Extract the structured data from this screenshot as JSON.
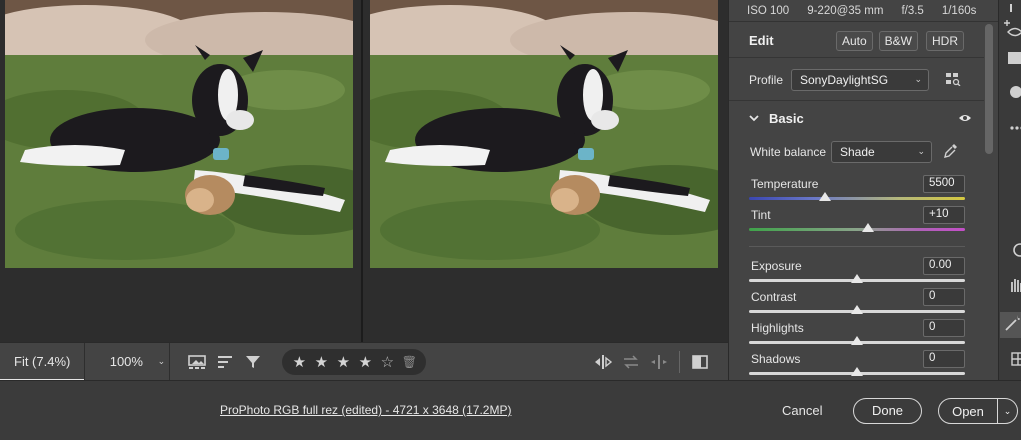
{
  "meta": {
    "iso": "ISO 100",
    "lens": "9-220@35 mm",
    "aperture": "f/3.5",
    "shutter": "1/160s"
  },
  "edit": {
    "title": "Edit",
    "auto_label": "Auto",
    "bw_label": "B&W",
    "hdr_label": "HDR"
  },
  "profile": {
    "label": "Profile",
    "value": "SonyDaylightSG"
  },
  "basic": {
    "title": "Basic",
    "white_balance_label": "White balance",
    "white_balance_value": "Shade",
    "sliders": {
      "temperature": {
        "label": "Temperature",
        "value": "5500",
        "position": 0.35
      },
      "tint": {
        "label": "Tint",
        "value": "+10",
        "position": 0.55
      },
      "exposure": {
        "label": "Exposure",
        "value": "0.00",
        "position": 0.5
      },
      "contrast": {
        "label": "Contrast",
        "value": "0",
        "position": 0.5
      },
      "highlights": {
        "label": "Highlights",
        "value": "0",
        "position": 0.5
      },
      "shadows": {
        "label": "Shadows",
        "value": "0",
        "position": 0.5
      }
    }
  },
  "toolbar": {
    "fit_label": "Fit (7.4%)",
    "zoom_label": "100%",
    "rating": 4
  },
  "footer": {
    "file_info": "ProPhoto RGB full rez (edited) - 4721 x 3648 (17.2MP)",
    "cancel_label": "Cancel",
    "done_label": "Done",
    "open_label": "Open"
  },
  "colors": {
    "panel_bg": "#444444",
    "preview_bg": "#2d2d2d",
    "grass": "#5f7d3c",
    "dog_black": "#1c1a1e"
  }
}
